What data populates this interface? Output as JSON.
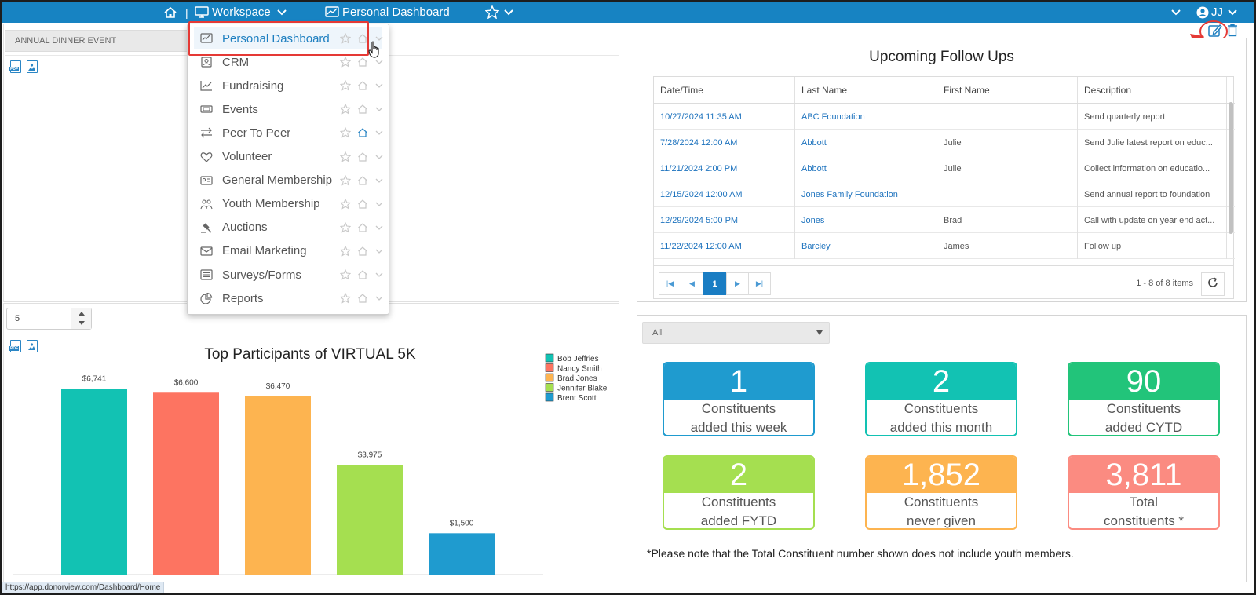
{
  "topbar": {
    "workspace_label": "Workspace",
    "dashboard_label": "Personal Dashboard",
    "user_initials": "JJ"
  },
  "left_top": {
    "event_select": "ANNUAL DINNER EVENT"
  },
  "nav_menu": {
    "items": [
      {
        "label": "Personal Dashboard",
        "icon": "dashboard-icon",
        "home": false
      },
      {
        "label": "CRM",
        "icon": "contact-card-icon",
        "home": false
      },
      {
        "label": "Fundraising",
        "icon": "trend-chart-icon",
        "home": false
      },
      {
        "label": "Events",
        "icon": "ticket-icon",
        "home": false
      },
      {
        "label": "Peer To Peer",
        "icon": "swap-arrows-icon",
        "home": true
      },
      {
        "label": "Volunteer",
        "icon": "heart-icon",
        "home": false
      },
      {
        "label": "General Membership",
        "icon": "id-card-icon",
        "home": false
      },
      {
        "label": "Youth Membership",
        "icon": "youth-icon",
        "home": false
      },
      {
        "label": "Auctions",
        "icon": "gavel-icon",
        "home": false
      },
      {
        "label": "Email Marketing",
        "icon": "envelope-icon",
        "home": false
      },
      {
        "label": "Surveys/Forms",
        "icon": "list-icon",
        "home": false
      },
      {
        "label": "Reports",
        "icon": "pie-chart-icon",
        "home": false
      }
    ]
  },
  "left_bottom": {
    "count_value": "5",
    "chart_title": "Top Participants of VIRTUAL 5K"
  },
  "chart_data": {
    "type": "bar",
    "title": "Top Participants of VIRTUAL 5K",
    "categories": [
      "Bob Jeffries",
      "Nancy Smith",
      "Brad Jones",
      "Jennifer Blake",
      "Brent Scott"
    ],
    "values": [
      6741,
      6600,
      6470,
      3975,
      1500
    ],
    "data_labels": [
      "$6,741",
      "$6,600",
      "$6,470",
      "$3,975",
      "$1,500"
    ],
    "colors": [
      "#12c2b3",
      "#fd7461",
      "#fdb450",
      "#a5df50",
      "#1f9bcf"
    ],
    "ylim": [
      0,
      8000
    ],
    "legend": "top-right",
    "grid": false
  },
  "follow_ups": {
    "title": "Upcoming Follow Ups",
    "columns": [
      "Date/Time",
      "Last Name",
      "First Name",
      "Description"
    ],
    "rows": [
      {
        "date": "10/27/2024 11:35 AM",
        "last": "ABC Foundation",
        "first": "",
        "desc": "Send quarterly report"
      },
      {
        "date": "7/28/2024 12:00 AM",
        "last": "Abbott",
        "first": "Julie",
        "desc": "Send Julie latest report on educ..."
      },
      {
        "date": "11/21/2024 2:00 PM",
        "last": "Abbott",
        "first": "Julie",
        "desc": "Collect information on educatio..."
      },
      {
        "date": "12/15/2024 12:00 AM",
        "last": "Jones Family Foundation",
        "first": "",
        "desc": "Send annual report to foundation"
      },
      {
        "date": "12/29/2024 5:00 PM",
        "last": "Jones",
        "first": "Brad",
        "desc": "Call with update on year end act..."
      },
      {
        "date": "11/22/2024 12:00 AM",
        "last": "Barcley",
        "first": "James",
        "desc": "Follow up"
      }
    ],
    "current_page": "1",
    "items_info": "1 - 8 of 8 items"
  },
  "stats": {
    "filter_value": "All",
    "cards": [
      {
        "number": "1",
        "line1": "Constituents",
        "line2": "added this week",
        "color": "#1f9bcf"
      },
      {
        "number": "2",
        "line1": "Constituents",
        "line2": "added this month",
        "color": "#12c2b3"
      },
      {
        "number": "90",
        "line1": "Constituents",
        "line2": "added CYTD",
        "color": "#22c47a"
      },
      {
        "number": "2",
        "line1": "Constituents",
        "line2": "added FYTD",
        "color": "#a5df50"
      },
      {
        "number": "1,852",
        "line1": "Constituents",
        "line2": "never given",
        "color": "#fdb450"
      },
      {
        "number": "3,811",
        "line1": "Total",
        "line2": "constituents *",
        "color": "#fb8b81"
      }
    ],
    "note": "*Please note that the Total Constituent number shown does not include youth members."
  },
  "status_bar": {
    "url": "https://app.donorview.com/Dashboard/Home"
  }
}
